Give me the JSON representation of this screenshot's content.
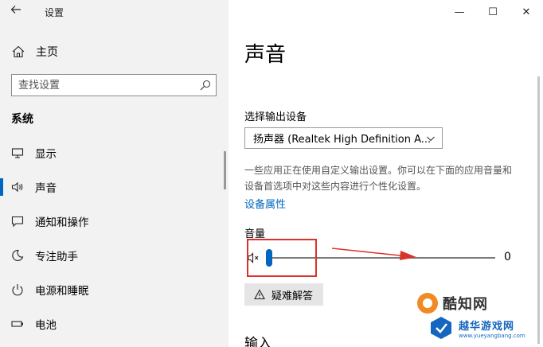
{
  "window": {
    "app_title": "设置",
    "back_icon": "back-arrow-icon",
    "controls": {
      "minimize": "—",
      "maximize": "☐",
      "close": "✕"
    }
  },
  "sidebar": {
    "home_label": "主页",
    "search_placeholder": "查找设置",
    "section_title": "系统",
    "items": [
      {
        "label": "显示",
        "icon": "monitor-icon",
        "active": false
      },
      {
        "label": "声音",
        "icon": "speaker-icon",
        "active": true
      },
      {
        "label": "通知和操作",
        "icon": "message-icon",
        "active": false
      },
      {
        "label": "专注助手",
        "icon": "moon-icon",
        "active": false
      },
      {
        "label": "电源和睡眠",
        "icon": "power-icon",
        "active": false
      },
      {
        "label": "电池",
        "icon": "battery-icon",
        "active": false
      }
    ]
  },
  "main": {
    "title": "声音",
    "output_label": "选择输出设备",
    "output_device": "扬声器 (Realtek High Definition A...",
    "description": "一些应用正在使用自定义输出设置。你可以在下面的应用音量和设备首选项中对这些内容进行个性化设置。",
    "device_properties_link": "设备属性",
    "volume_label": "音量",
    "volume_value": "0",
    "volume_level": 0,
    "troubleshoot_label": "疑难解答",
    "input_heading": "输入"
  },
  "watermark": {
    "brand_1": "酷知网",
    "brand_2": "越华游戏网",
    "url": "www.yueyangbang.com"
  },
  "colors": {
    "accent": "#0067c0",
    "annotation": "#d9342b"
  }
}
